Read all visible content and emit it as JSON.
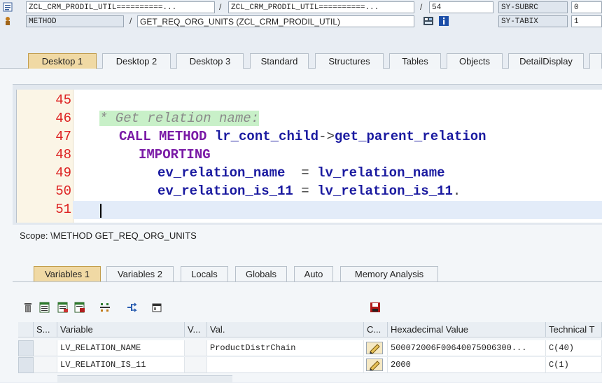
{
  "header": {
    "program_field": "ZCL_CRM_PRODIL_UTIL==========...",
    "include_field": "ZCL_CRM_PRODIL_UTIL==========...",
    "line_field": "54",
    "event_type": "METHOD",
    "event_name": "GET_REQ_ORG_UNITS (ZCL_CRM_PRODIL_UTIL)",
    "sys_var_1": "SY-SUBRC",
    "sys_val_1": "0",
    "sys_var_2": "SY-TABIX",
    "sys_val_2": "1"
  },
  "desktop_tabs": [
    "Desktop 1",
    "Desktop 2",
    "Desktop 3",
    "Standard",
    "Structures",
    "Tables",
    "Objects",
    "DetailDisplay"
  ],
  "code": {
    "line_numbers": [
      "45",
      "46",
      "47",
      "48",
      "49",
      "50",
      "51"
    ],
    "comment": "* Get relation name:",
    "call_kw": "CALL METHOD",
    "call_obj": "lr_cont_child",
    "arrow": "->",
    "call_method": "get_parent_relation",
    "importing_kw": "IMPORTING",
    "param1": "ev_relation_name",
    "eq1": "=",
    "val1": "lv_relation_name",
    "param2": "ev_relation_is_11",
    "eq2": "=",
    "val2": "lv_relation_is_11",
    "end": "."
  },
  "scope": "Scope: \\METHOD GET_REQ_ORG_UNITS",
  "variable_tabs": [
    "Variables 1",
    "Variables 2",
    "Locals",
    "Globals",
    "Auto",
    "Memory Analysis"
  ],
  "toolbar_icons": [
    "delete-icon",
    "table-view-icon",
    "table-edit-icon",
    "table-save-icon",
    "structure-icon",
    "share-icon",
    "layout-icon",
    "save-icon"
  ],
  "table": {
    "headers": [
      "S...",
      "Variable",
      "V...",
      "Val.",
      "C...",
      "Hexadecimal Value",
      "Technical T"
    ],
    "rows": [
      {
        "variable": "LV_RELATION_NAME",
        "value": "ProductDistrChain",
        "hex": "500072006F00640075006300...",
        "technical": "C(40)"
      },
      {
        "variable": "LV_RELATION_IS_11",
        "value": "",
        "hex": "2000",
        "technical": "C(1)"
      }
    ]
  },
  "colors": {
    "active_tab": "#f0d9a4",
    "line_number": "#d22222",
    "keyword": "#7a1aa6",
    "identifier": "#1a1aa0"
  }
}
